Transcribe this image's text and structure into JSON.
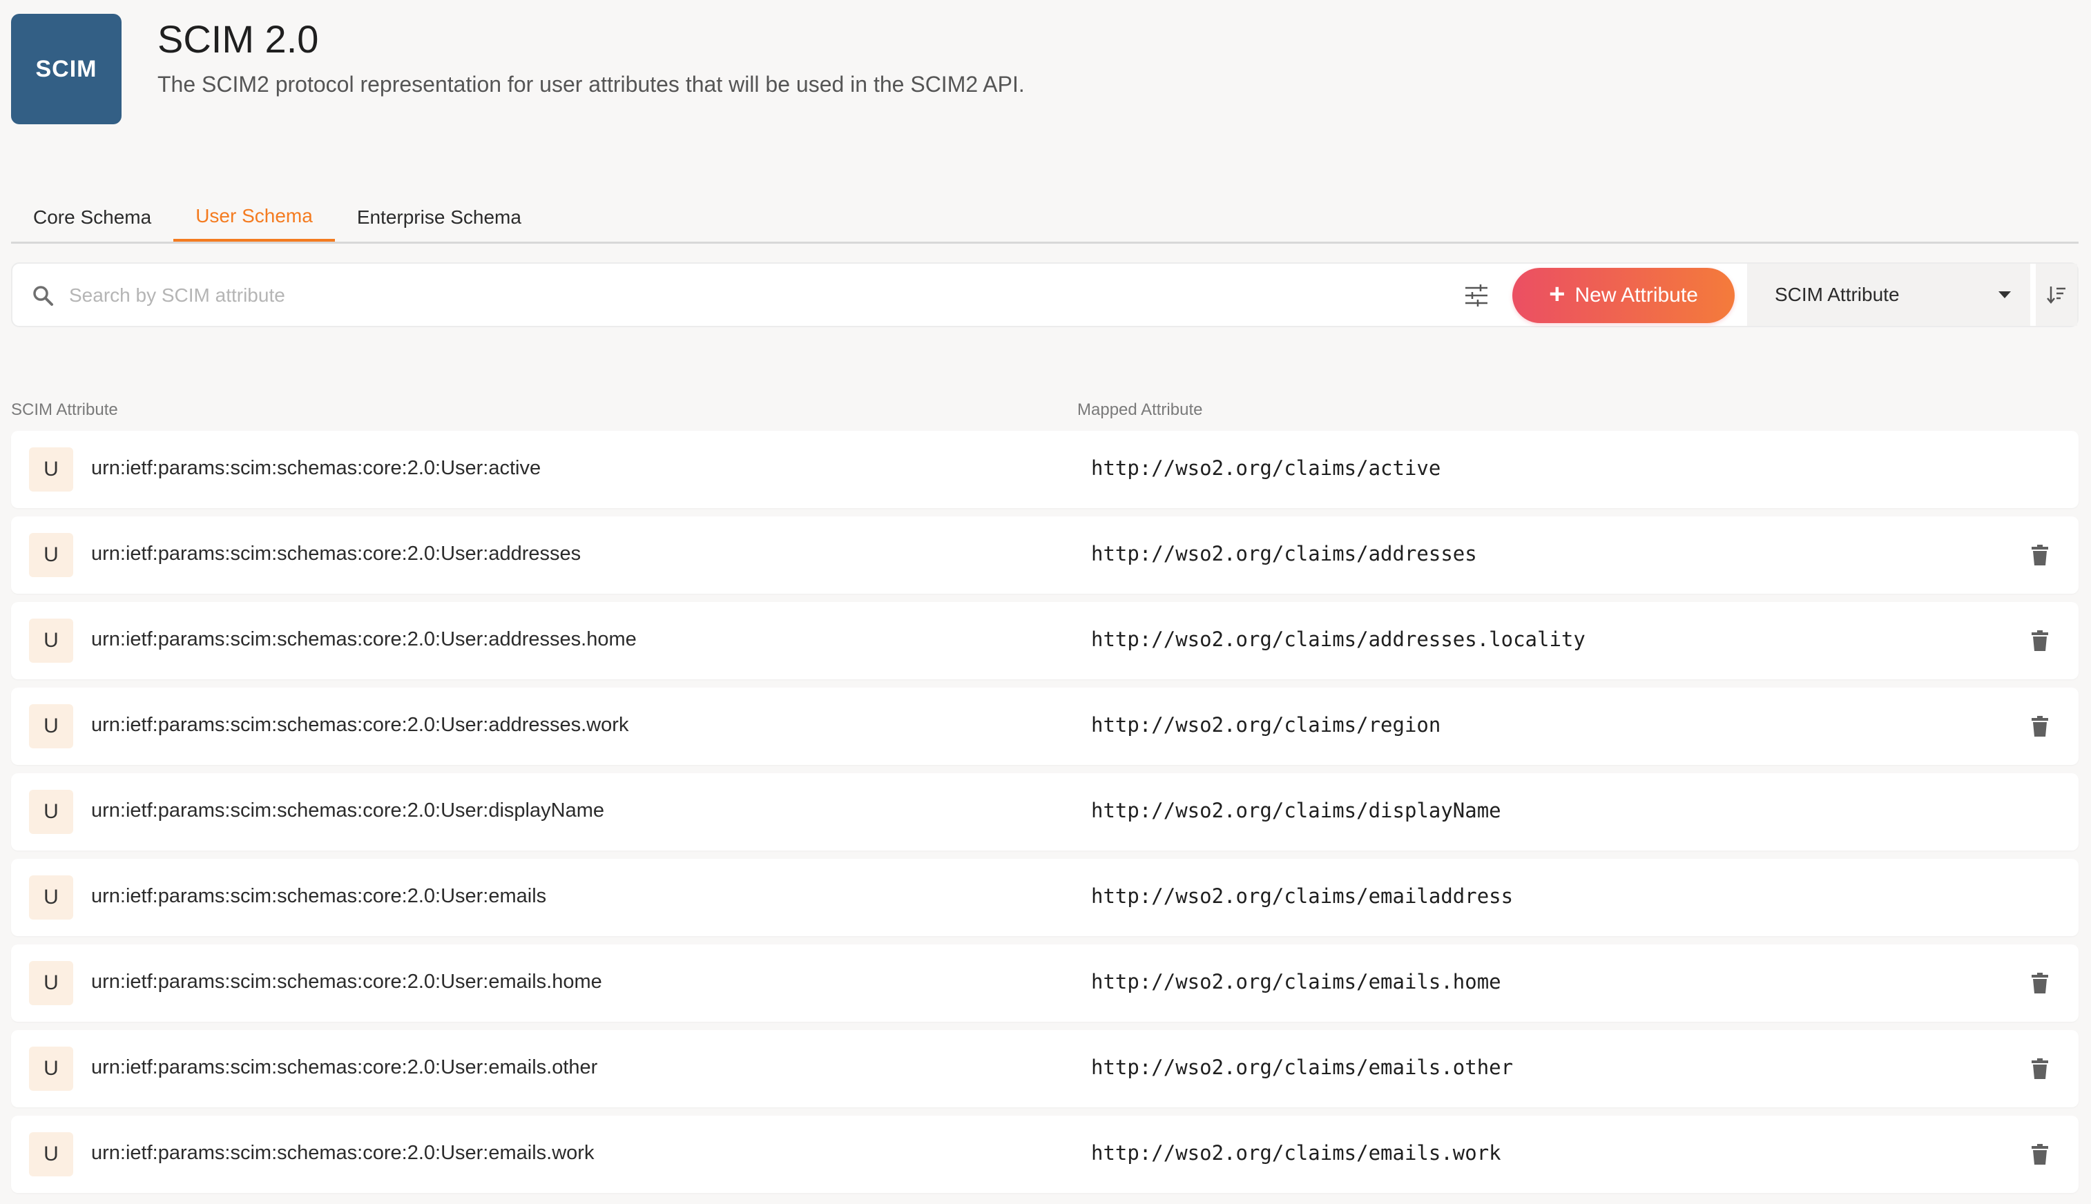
{
  "header": {
    "logo_text": "SCIM",
    "title": "SCIM 2.0",
    "subtitle": "The SCIM2 protocol representation for user attributes that will be used in the SCIM2 API."
  },
  "tabs": [
    {
      "label": "Core Schema",
      "active": false
    },
    {
      "label": "User Schema",
      "active": true
    },
    {
      "label": "Enterprise Schema",
      "active": false
    }
  ],
  "toolbar": {
    "search_placeholder": "Search by SCIM attribute",
    "new_attribute_label": "New Attribute",
    "sort_by": "SCIM Attribute"
  },
  "table": {
    "columns": [
      "SCIM Attribute",
      "Mapped Attribute"
    ],
    "rows": [
      {
        "badge": "U",
        "scim": "urn:ietf:params:scim:schemas:core:2.0:User:active",
        "mapped": "http://wso2.org/claims/active",
        "deletable": false
      },
      {
        "badge": "U",
        "scim": "urn:ietf:params:scim:schemas:core:2.0:User:addresses",
        "mapped": "http://wso2.org/claims/addresses",
        "deletable": true
      },
      {
        "badge": "U",
        "scim": "urn:ietf:params:scim:schemas:core:2.0:User:addresses.home",
        "mapped": "http://wso2.org/claims/addresses.locality",
        "deletable": true
      },
      {
        "badge": "U",
        "scim": "urn:ietf:params:scim:schemas:core:2.0:User:addresses.work",
        "mapped": "http://wso2.org/claims/region",
        "deletable": true
      },
      {
        "badge": "U",
        "scim": "urn:ietf:params:scim:schemas:core:2.0:User:displayName",
        "mapped": "http://wso2.org/claims/displayName",
        "deletable": false
      },
      {
        "badge": "U",
        "scim": "urn:ietf:params:scim:schemas:core:2.0:User:emails",
        "mapped": "http://wso2.org/claims/emailaddress",
        "deletable": false
      },
      {
        "badge": "U",
        "scim": "urn:ietf:params:scim:schemas:core:2.0:User:emails.home",
        "mapped": "http://wso2.org/claims/emails.home",
        "deletable": true
      },
      {
        "badge": "U",
        "scim": "urn:ietf:params:scim:schemas:core:2.0:User:emails.other",
        "mapped": "http://wso2.org/claims/emails.other",
        "deletable": true
      },
      {
        "badge": "U",
        "scim": "urn:ietf:params:scim:schemas:core:2.0:User:emails.work",
        "mapped": "http://wso2.org/claims/emails.work",
        "deletable": true
      }
    ]
  },
  "colors": {
    "accent": "#f47b20",
    "button_gradient_start": "#eb4f63",
    "button_gradient_end": "#f47b3b",
    "logo_bg": "#335f85"
  },
  "icons": {
    "search": "search-icon",
    "filter": "filter-icon",
    "plus": "plus-icon",
    "caret": "chevron-down-icon",
    "sort_order": "sort-order-icon",
    "delete": "trash-icon"
  }
}
